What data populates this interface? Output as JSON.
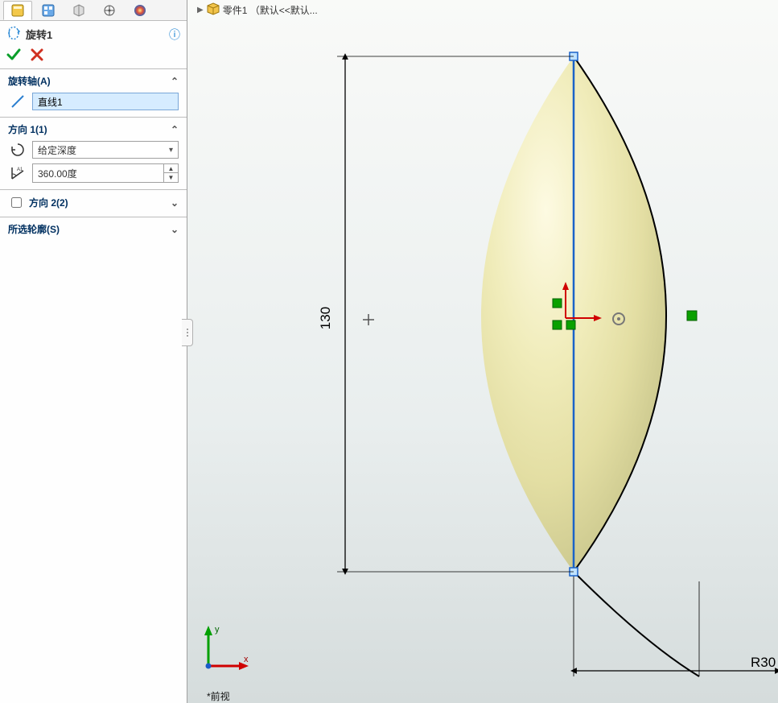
{
  "breadcrumb": {
    "part_label": "零件1 （默认<<默认..."
  },
  "feature": {
    "title": "旋转1",
    "ok": "✓",
    "cancel": "✕"
  },
  "sections": {
    "axis": {
      "title": "旋转轴(A)",
      "input_value": "直线1"
    },
    "dir1": {
      "title": "方向 1(1)",
      "type_value": "给定深度",
      "angle_value": "360.00度"
    },
    "dir2": {
      "checkbox_label": "方向 2(2)"
    },
    "contour": {
      "title": "所选轮廓(S)"
    }
  },
  "viewport": {
    "dim_vertical": "130",
    "dim_radius": "R30",
    "triad_x": "x",
    "triad_y": "y"
  },
  "footer": {
    "view_label": "*前视"
  },
  "icons": {
    "help": "?"
  }
}
